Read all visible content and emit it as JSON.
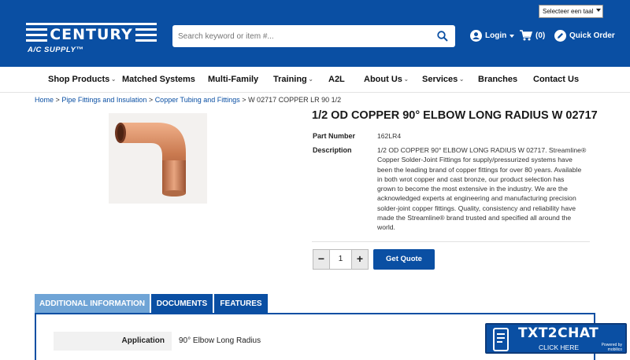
{
  "header": {
    "logo_text": "CENTURY",
    "logo_subtitle": "A/C SUPPLY™",
    "language_select": "Selecteer een taal",
    "search_placeholder": "Search keyword or item #...",
    "login_label": "Login",
    "cart_count": "(0)",
    "quick_order_label": "Quick Order",
    "brand_color": "#0a4fa3"
  },
  "nav": {
    "items": [
      {
        "label": "Shop Products",
        "has_dropdown": true
      },
      {
        "label": "Matched Systems",
        "has_dropdown": false
      },
      {
        "label": "Multi-Family",
        "has_dropdown": false
      },
      {
        "label": "Training",
        "has_dropdown": true
      },
      {
        "label": "A2L",
        "has_dropdown": false
      },
      {
        "label": "About Us",
        "has_dropdown": true
      },
      {
        "label": "Services",
        "has_dropdown": true
      },
      {
        "label": "Branches",
        "has_dropdown": false
      },
      {
        "label": "Contact Us",
        "has_dropdown": false
      }
    ]
  },
  "breadcrumb": {
    "items": [
      "Home",
      "Pipe Fittings and Insulation",
      "Copper Tubing and Fittings"
    ],
    "separator": ">",
    "current": "W 02717 COPPER LR 90 1/2"
  },
  "product": {
    "title": "1/2 OD COPPER 90° ELBOW LONG RADIUS W 02717",
    "part_number_label": "Part Number",
    "part_number": "162LR4",
    "description_label": "Description",
    "description_lines": [
      "1/2 OD COPPER 90° ELBOW LONG RADIUS W 02717. Streamline®",
      "Copper Solder-Joint Fittings for supply/pressurized systems have",
      "been the leading brand of copper fittings for over 80 years. Available",
      "in both wrot copper and cast bronze, our product selection has",
      "grown to become the most extensive in the industry. We are the",
      "acknowledged experts at engineering and manufacturing precision",
      "solder-joint copper fittings. Quality, consistency and reliability have",
      "made the Streamline® brand trusted and specified all around the",
      "world."
    ],
    "quantity": "1",
    "decrement_label": "−",
    "increment_label": "+",
    "get_quote_label": "Get Quote"
  },
  "tabs": {
    "items": [
      {
        "label": "ADDITIONAL INFORMATION",
        "active": true
      },
      {
        "label": "DOCUMENTS",
        "active": false
      },
      {
        "label": "FEATURES",
        "active": false
      }
    ],
    "active_color": "#6fa4d6"
  },
  "additional_info": {
    "rows": [
      {
        "label": "Application",
        "value": "90° Elbow Long Radius"
      }
    ]
  },
  "chat_widget": {
    "title": "TXT2CHAT",
    "subtitle": "CLICK HERE",
    "powered_by": "Powered by",
    "powered_brand": "mobilico"
  }
}
